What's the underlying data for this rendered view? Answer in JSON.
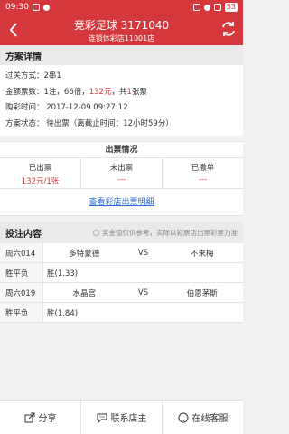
{
  "status_bar": {
    "time": "09:30",
    "battery": "53"
  },
  "header": {
    "title": "竞彩足球  3171040",
    "subtitle": "连锁体彩店11001店"
  },
  "plan": {
    "section_title": "方案详情",
    "pass_mode": "过关方式：2串1",
    "amount_prefix": "金额票数：1注，66倍，",
    "amount_red": "132元",
    "amount_mid": "，共",
    "amount_count": "1",
    "amount_suffix": "张票",
    "buy_time": "购彩时间：  2017-12-09 09:27:12",
    "status": "方案状态：  待出票（离截止时间：12小时59分）"
  },
  "ticket": {
    "title": "出票情况",
    "columns": [
      {
        "label": "已出票",
        "value": "132元/1张"
      },
      {
        "label": "未出票",
        "value": "---"
      },
      {
        "label": "已撤单",
        "value": "---"
      }
    ],
    "link": "查看彩店出票明细"
  },
  "bets": {
    "title": "投注内容",
    "note": "奖金值仅供参考，实际以彩票店出票彩票为准",
    "rows": [
      {
        "type": "match",
        "c1": "周六014",
        "home": "多特蒙德",
        "vs": "VS",
        "away": "不来梅"
      },
      {
        "type": "result",
        "c1": "胜平负",
        "result": "胜(1.33)"
      },
      {
        "type": "match",
        "c1": "周六019",
        "home": "水晶宫",
        "vs": "VS",
        "away": "伯恩茅斯"
      },
      {
        "type": "result",
        "c1": "胜平负",
        "result": "胜(1.84)"
      }
    ]
  },
  "bottom_bar": {
    "share": "分享",
    "contact": "联系店主",
    "service": "在线客服"
  },
  "colors": {
    "accent": "#d5383c",
    "link": "#2c6bd5"
  }
}
